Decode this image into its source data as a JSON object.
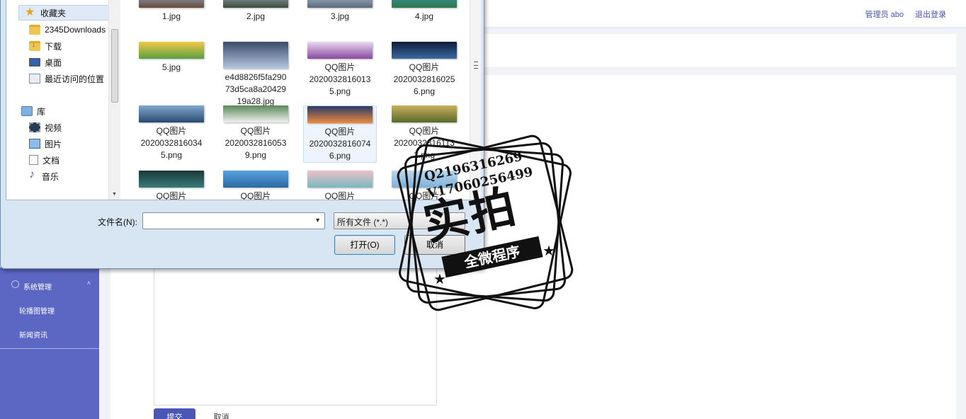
{
  "topbar": {
    "admin_label": "管理员 abo",
    "logout_label": "退出登录"
  },
  "sidebar": {
    "group_label": "系统管理",
    "items": [
      {
        "label": "轮播图管理"
      },
      {
        "label": "新闻资讯"
      }
    ]
  },
  "form": {
    "save_label": "提交",
    "cancel_label": "取消"
  },
  "dialog": {
    "nav": [
      {
        "label": "收藏夹",
        "icon": "star-icon"
      },
      {
        "label": "2345Downloads",
        "icon": "folder-icon"
      },
      {
        "label": "下载",
        "icon": "download-folder-icon"
      },
      {
        "label": "桌面",
        "icon": "desktop-icon"
      },
      {
        "label": "最近访问的位置",
        "icon": "recent-places-icon"
      },
      {
        "label": "库",
        "icon": "library-icon"
      },
      {
        "label": "视频",
        "icon": "video-icon"
      },
      {
        "label": "图片",
        "icon": "pictures-icon"
      },
      {
        "label": "文档",
        "icon": "documents-icon"
      },
      {
        "label": "音乐",
        "icon": "music-icon"
      }
    ],
    "files": [
      {
        "name": "1.jpg",
        "color_a": "#8eb0d8",
        "color_b": "#6a4a3a"
      },
      {
        "name": "2.jpg",
        "color_a": "#9fb6c8",
        "color_b": "#3d4d3a"
      },
      {
        "name": "3.jpg",
        "color_a": "#b8c8d8",
        "color_b": "#5a6a7a"
      },
      {
        "name": "4.jpg",
        "color_a": "#3f8fc0",
        "color_b": "#2f7a4a"
      },
      {
        "name": "5.jpg",
        "color_a": "#f2c84a",
        "color_b": "#5aa040"
      },
      {
        "name": "e4d8826f5fa290\n73d5ca8a20429\n19a28.jpg",
        "color_a": "#3a4a6a",
        "color_b": "#b8c8e0"
      },
      {
        "name": "QQ图片\n2020032816013\n5.png",
        "color_a": "#e8d8f0",
        "color_b": "#8a4aa0"
      },
      {
        "name": "QQ图片\n2020032816025\n6.png",
        "color_a": "#0f1a3a",
        "color_b": "#3a6aa0"
      },
      {
        "name": "QQ图片\n2020032816034\n5.png",
        "color_a": "#7fa8d0",
        "color_b": "#2a4a70"
      },
      {
        "name": "QQ图片\n2020032816053\n9.png",
        "color_a": "#5a8a5a",
        "color_b": "#f0f0f0"
      },
      {
        "name": "QQ图片\n2020032816074\n6.png",
        "color_a": "#2a3a6a",
        "color_b": "#f08a3a"
      },
      {
        "name": "QQ图片\n2020032816113\n1.png",
        "color_a": "#c8b060",
        "color_b": "#5a6a2a"
      },
      {
        "name": "QQ图片",
        "color_a": "#1a3a3a",
        "color_b": "#3a7a7a"
      },
      {
        "name": "QQ图片",
        "color_a": "#5aa0e0",
        "color_b": "#2a6aa0"
      },
      {
        "name": "QQ图片",
        "color_a": "#f0c0c8",
        "color_b": "#7ab8c0"
      },
      {
        "name": "QQ图片",
        "color_a": "#b8d8f0",
        "color_b": "#7fb0d8"
      }
    ],
    "filename_label": "文件名(N):",
    "filename_value": "",
    "filter_value": "所有文件 (*.*)",
    "open_label": "打开(O)",
    "cancel_label": "取消"
  },
  "watermark": {
    "qq_line": "Q2196316269",
    "v_line": "V17060256499",
    "main_text": "实拍",
    "ribbon_text": "全微程序"
  }
}
